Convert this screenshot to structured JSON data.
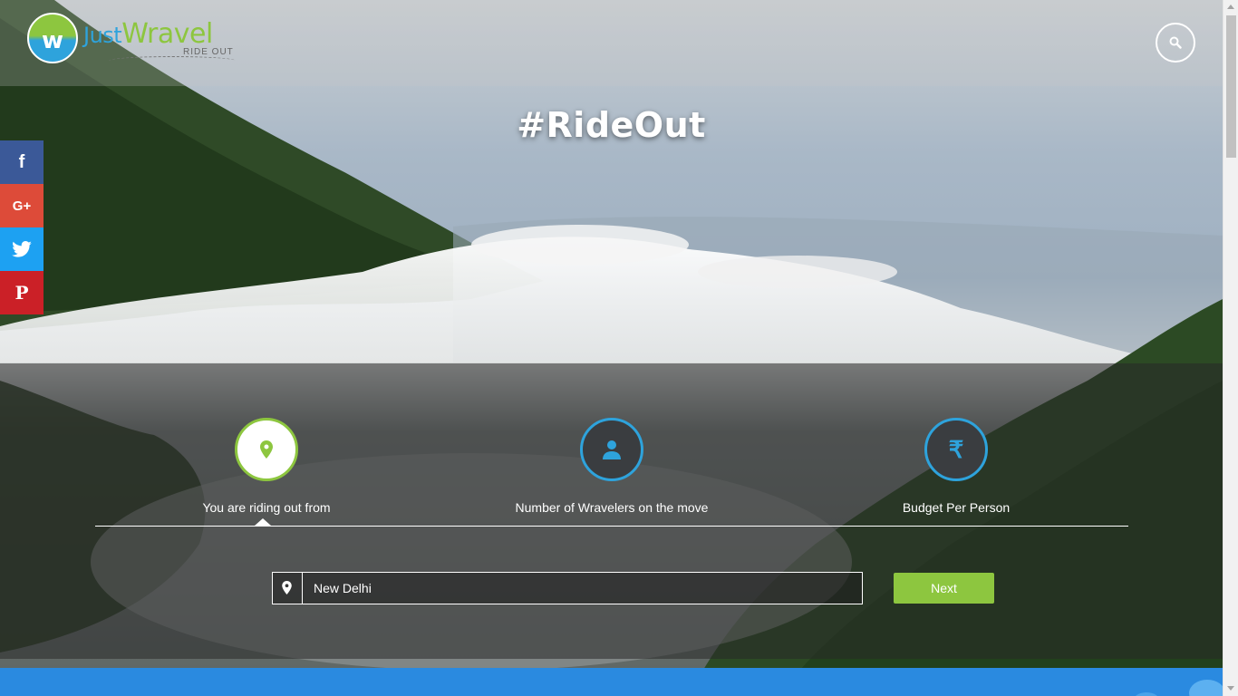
{
  "brand": {
    "mark": "w",
    "name_part1": "Just",
    "name_part2": "Wravel",
    "tagline": "RIDE OUT"
  },
  "hero": {
    "hashtag": "#RideOut"
  },
  "social": {
    "items": [
      {
        "name": "facebook",
        "glyph": "f"
      },
      {
        "name": "google-plus",
        "glyph": "G+"
      },
      {
        "name": "twitter",
        "glyph": "twitter-bird"
      },
      {
        "name": "pinterest",
        "glyph": "P"
      }
    ]
  },
  "steps": [
    {
      "label": "You are riding out from",
      "icon": "map-marker-icon",
      "active": true
    },
    {
      "label": "Number of Wravelers on the move",
      "icon": "user-icon",
      "active": false
    },
    {
      "label": "Budget Per Person",
      "icon": "rupee-icon",
      "symbol": "₹",
      "active": false
    }
  ],
  "form": {
    "location_value": "New Delhi",
    "next_label": "Next"
  },
  "colors": {
    "green": "#8dc63f",
    "blue": "#2ea3dc",
    "bottom_bar": "#2a8ae0"
  }
}
